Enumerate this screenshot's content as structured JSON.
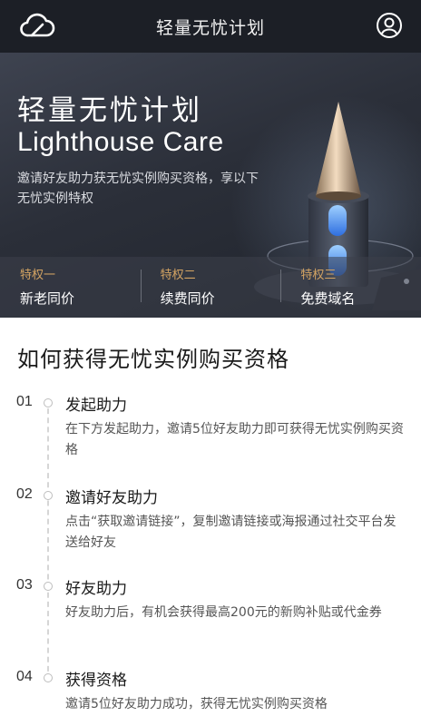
{
  "topbar": {
    "title": "轻量无忧计划",
    "left_icon": "cloud-logo-icon",
    "right_icon": "user-avatar-icon"
  },
  "hero": {
    "title_cn": "轻量无忧计划",
    "title_en": "Lighthouse Care",
    "description": "邀请好友助力获无忧实例购买资格，享以下无忧实例特权",
    "privileges": [
      {
        "label": "特权一",
        "value": "新老同价"
      },
      {
        "label": "特权二",
        "value": "续费同价"
      },
      {
        "label": "特权三",
        "value": "免费域名"
      }
    ]
  },
  "section": {
    "title": "如何获得无忧实例购买资格"
  },
  "steps": [
    {
      "num": "01",
      "title": "发起助力",
      "desc": "在下方发起助力，邀请5位好友助力即可获得无忧实例购买资格"
    },
    {
      "num": "02",
      "title": "邀请好友助力",
      "desc": "点击“获取邀请链接”，复制邀请链接或海报通过社交平台发送给好友"
    },
    {
      "num": "03",
      "title": "好友助力",
      "desc": "好友助力后，有机会获得最高200元的新购补贴或代金券"
    },
    {
      "num": "04",
      "title": "获得资格",
      "desc": "邀请5位好友助力成功，获得无忧实例购买资格"
    }
  ],
  "colors": {
    "topbar_bg": "#1c1f26",
    "accent_gold": "#d4a463",
    "hero_bg": "#2b2f39"
  }
}
